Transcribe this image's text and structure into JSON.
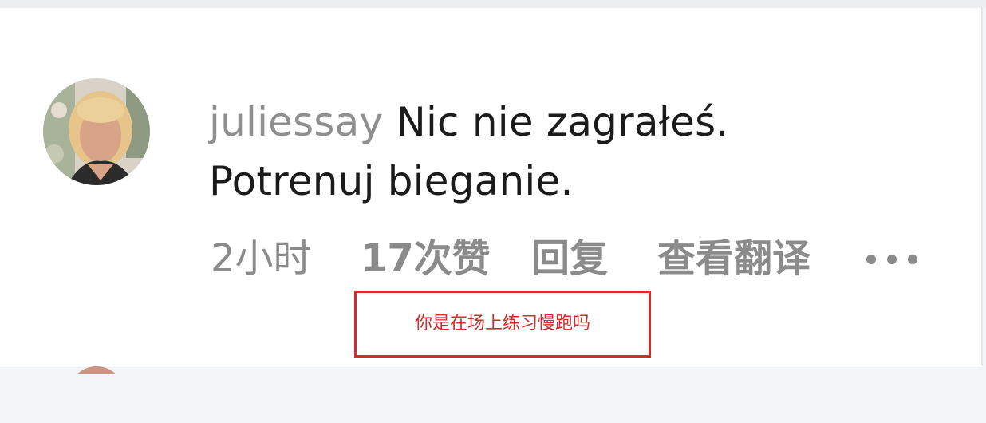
{
  "comment": {
    "username": "juliessay",
    "text": "Nic nie zagrałeś. Potrenuj bieganie.",
    "meta": {
      "time": "2小时",
      "likes": "17次赞",
      "reply": "回复",
      "translate": "查看翻译"
    },
    "icons": {
      "avatar": "user-avatar",
      "more": "more-options-icon"
    }
  },
  "annotation": {
    "text": "你是在场上练习慢跑吗",
    "color": "#d42a2a"
  }
}
